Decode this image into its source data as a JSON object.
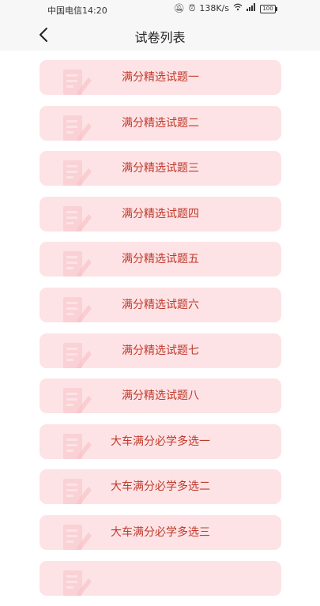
{
  "status_bar": {
    "carrier_time": "中国电信14:20",
    "net_speed": "138K/s",
    "battery": "100",
    "icons": [
      "mute-icon",
      "alarm-icon",
      "wifi-icon",
      "signal-4g-icon",
      "battery-icon"
    ]
  },
  "header": {
    "title": "试卷列表",
    "back_icon": "chevron-left-icon"
  },
  "colors": {
    "item_background": "#fde3e5",
    "item_text": "#c0392b",
    "watermark_icon": "#f8c3c8"
  },
  "exams": [
    {
      "label": "满分精选试题一"
    },
    {
      "label": "满分精选试题二"
    },
    {
      "label": "满分精选试题三"
    },
    {
      "label": "满分精选试题四"
    },
    {
      "label": "满分精选试题五"
    },
    {
      "label": "满分精选试题六"
    },
    {
      "label": "满分精选试题七"
    },
    {
      "label": "满分精选试题八"
    },
    {
      "label": "大车满分必学多选一"
    },
    {
      "label": "大车满分必学多选二"
    },
    {
      "label": "大车满分必学多选三"
    },
    {
      "label": ""
    }
  ]
}
